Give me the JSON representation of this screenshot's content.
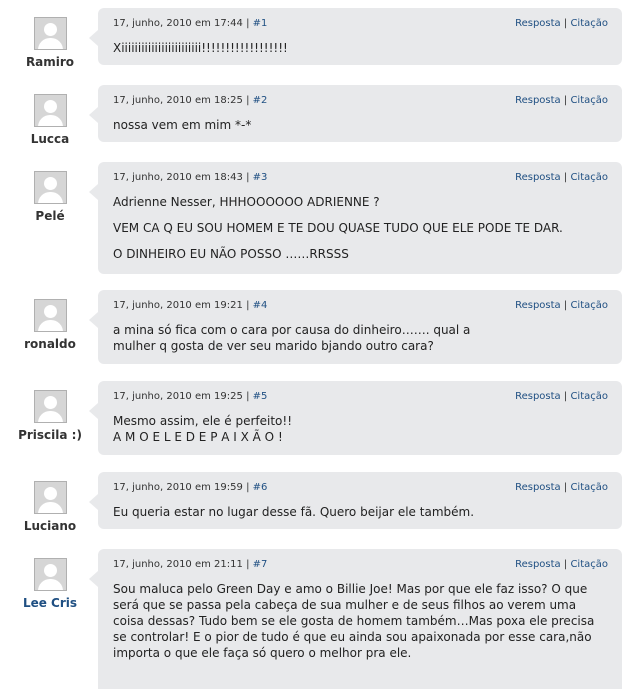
{
  "labels": {
    "reply": "Resposta",
    "quote": "Citação",
    "separator": "|"
  },
  "comments": [
    {
      "author": "Ramiro",
      "date": "17, junho, 2010 em 17:44",
      "num": "#1",
      "paras": [
        "Xiiiiiiiiiiiiiiiiiiiiiiii!!!!!!!!!!!!!!!!!!"
      ]
    },
    {
      "author": "Lucca",
      "date": "17, junho, 2010 em 18:25",
      "num": "#2",
      "paras": [
        "nossa vem em mim *-*"
      ]
    },
    {
      "author": "Pelé",
      "date": "17, junho, 2010 em 18:43",
      "num": "#3",
      "paras": [
        "Adrienne Nesser, HHHOOOOOO ADRIENNE ?",
        "VEM CA Q EU SOU HOMEM E TE DOU QUASE TUDO QUE ELE PODE TE DAR.",
        "O DINHEIRO EU NÃO POSSO ……RRSSS"
      ]
    },
    {
      "author": "ronaldo",
      "date": "17, junho, 2010 em 19:21",
      "num": "#4",
      "paras": [
        "a mina só fica com o cara por causa do dinheiro……. qual a mulher q gosta de ver seu marido bjando outro cara?"
      ]
    },
    {
      "author": "Priscila :)",
      "date": "17, junho, 2010 em 19:25",
      "num": "#5",
      "paras": [
        "Mesmo assim, ele é perfeito!! A M O E L E D E P A I X Ã O !"
      ]
    },
    {
      "author": "Luciano",
      "date": "17, junho, 2010 em 19:59",
      "num": "#6",
      "paras": [
        "Eu queria estar no lugar desse fã. Quero beijar ele também."
      ]
    },
    {
      "author": "Lee Cris",
      "date": "17, junho, 2010 em 21:11",
      "num": "#7",
      "paras": [
        "Sou maluca pelo Green Day e amo o Billie Joe! Mas por que ele faz isso? O que será que se passa pela cabeça de sua mulher e de seus filhos ao verem uma coisa dessas? Tudo bem se ele gosta de homem também…Mas poxa ele precisa se controlar! E o pior de tudo é que eu ainda sou apaixonada por esse cara,não importa o que ele faça só quero o melhor pra ele."
      ]
    }
  ]
}
